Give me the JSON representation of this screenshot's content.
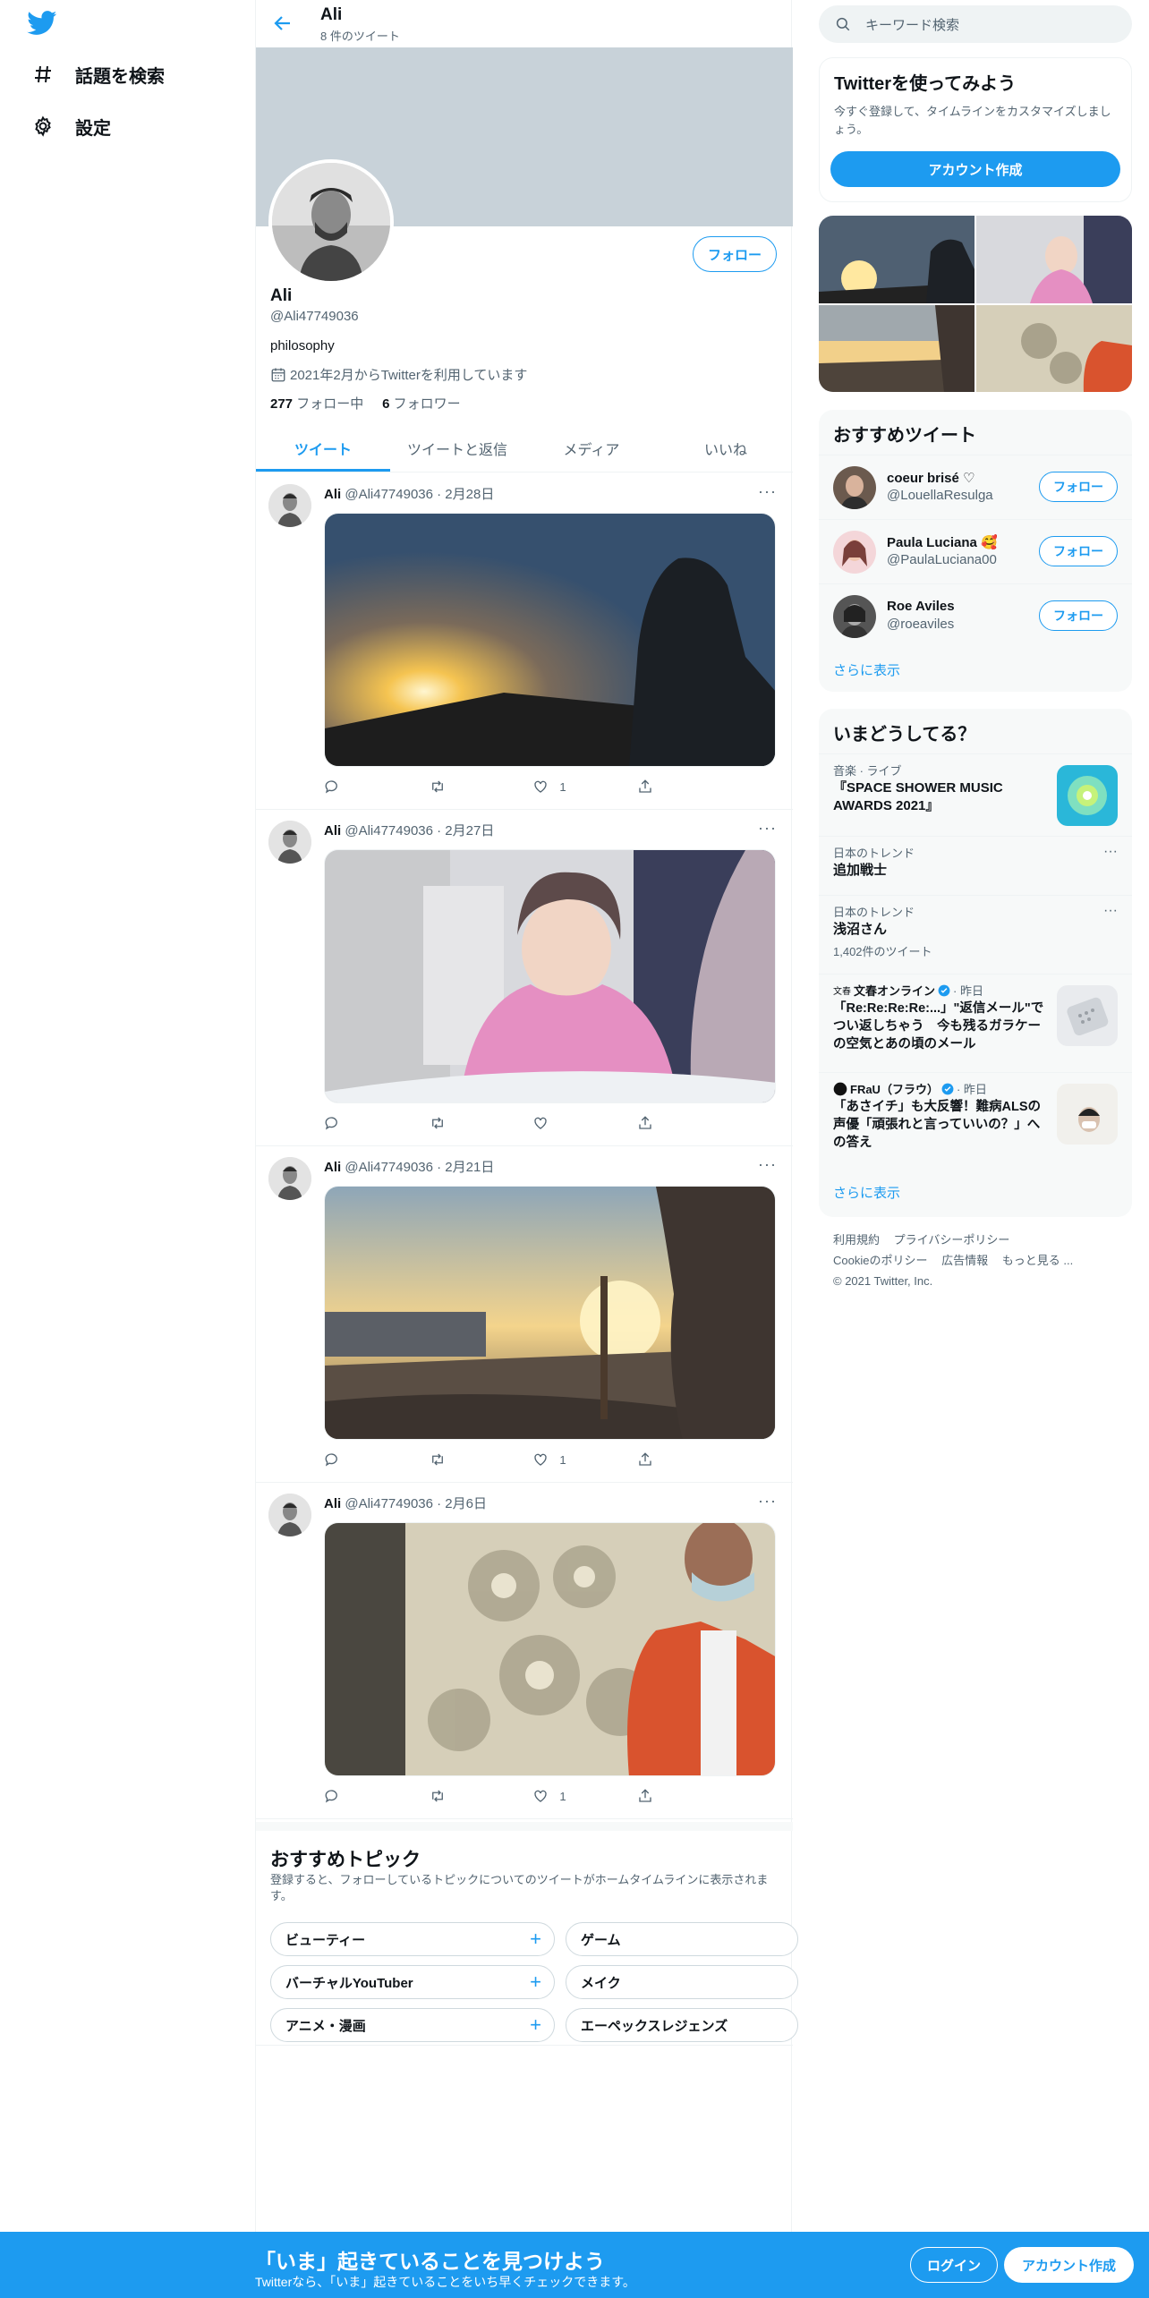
{
  "nav": {
    "explore": "話題を検索",
    "settings": "設定"
  },
  "profile": {
    "header_name": "Ali",
    "tweet_count": "8 件のツイート",
    "name": "Ali",
    "handle": "@Ali47749036",
    "bio": "philosophy",
    "joined": "2021年2月からTwitterを利用しています",
    "following_count": "277",
    "following_label": "フォロー中",
    "followers_count": "6",
    "followers_label": "フォロワー",
    "follow_button": "フォロー"
  },
  "tabs": [
    "ツイート",
    "ツイートと返信",
    "メディア",
    "いいね"
  ],
  "tweets": [
    {
      "name": "Ali",
      "meta": "@Ali47749036 · 2月28日",
      "likes": "1",
      "image": "sunset-selfie"
    },
    {
      "name": "Ali",
      "meta": "@Ali47749036 · 2月27日",
      "likes": "",
      "image": "child-pink-jacket"
    },
    {
      "name": "Ali",
      "meta": "@Ali47749036 · 2月21日",
      "likes": "1",
      "image": "harbor-sunset"
    },
    {
      "name": "Ali",
      "meta": "@Ali47749036 · 2月6日",
      "likes": "1",
      "image": "window-reflection"
    }
  ],
  "topics": {
    "title": "おすすめトピック",
    "subtitle": "登録すると、フォローしているトピックについてのツイートがホームタイムラインに表示されます。",
    "chips": [
      "ビューティー",
      "ゲーム",
      "バーチャルYouTuber",
      "メイク",
      "アニメ・漫画",
      "エーペックスレジェンズ"
    ]
  },
  "search": {
    "placeholder": "キーワード検索"
  },
  "join": {
    "title": "Twitterを使ってみよう",
    "text": "今すぐ登録して、タイムラインをカスタマイズしましょう。",
    "button": "アカウント作成"
  },
  "recommended": {
    "title": "おすすめツイート",
    "users": [
      {
        "name": "coeur brisé ♡",
        "handle": "@LouellaResulga",
        "button": "フォロー"
      },
      {
        "name": "Paula Luciana 🥰",
        "handle": "@PaulaLuciana00",
        "button": "フォロー"
      },
      {
        "name": "Roe Aviles",
        "handle": "@roeaviles",
        "button": "フォロー"
      }
    ],
    "more": "さらに表示"
  },
  "trends": {
    "title": "いまどうしてる？",
    "items": [
      {
        "meta": "音楽 · ライブ",
        "title": "『SPACE SHOWER MUSIC AWARDS 2021』"
      },
      {
        "meta": "日本のトレンド",
        "title": "追加戦士"
      },
      {
        "meta": "日本のトレンド",
        "title": "浅沼さん",
        "count": "1,402件のツイート"
      },
      {
        "meta": "文春オンライン",
        "meta2": "· 昨日",
        "title": "「Re:Re:Re:Re:...」\"返信メール\"でつい返しちゃう　今も残るガラケーの空気とあの頃のメール"
      },
      {
        "meta": "FRaU（フラウ）",
        "meta2": "· 昨日",
        "title": "「あさイチ」も大反響！難病ALSの声優「頑張れと言っていいの？」への答え"
      }
    ],
    "more": "さらに表示"
  },
  "footer": {
    "links": [
      "利用規約",
      "プライバシーポリシー",
      "Cookieのポリシー",
      "広告情報",
      "もっと見る ..."
    ],
    "copyright": "© 2021 Twitter, Inc."
  },
  "bottom": {
    "title": "「いま」起きていることを見つけよう",
    "subtitle": "Twitterなら、「いま」起きていることをいち早くチェックできます。",
    "login": "ログイン",
    "signup": "アカウント作成"
  },
  "colors": {
    "accent": "#1d9bf0",
    "banner": "#c8d2d9"
  }
}
